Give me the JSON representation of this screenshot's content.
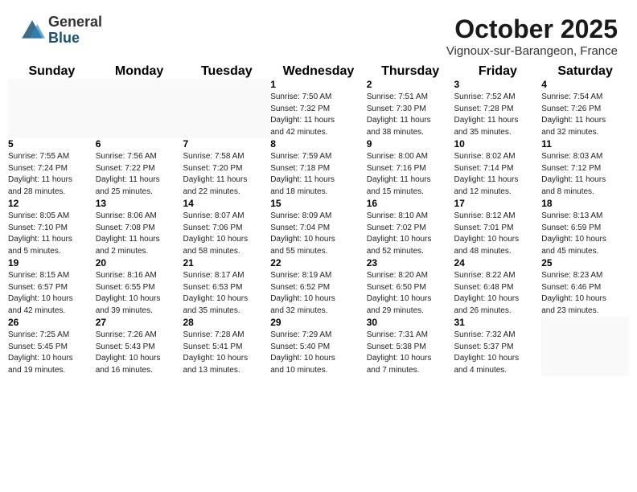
{
  "header": {
    "logo_general": "General",
    "logo_blue": "Blue",
    "month_title": "October 2025",
    "subtitle": "Vignoux-sur-Barangeon, France"
  },
  "days_of_week": [
    "Sunday",
    "Monday",
    "Tuesday",
    "Wednesday",
    "Thursday",
    "Friday",
    "Saturday"
  ],
  "weeks": [
    [
      {
        "day": "",
        "info": ""
      },
      {
        "day": "",
        "info": ""
      },
      {
        "day": "",
        "info": ""
      },
      {
        "day": "1",
        "info": "Sunrise: 7:50 AM\nSunset: 7:32 PM\nDaylight: 11 hours\nand 42 minutes."
      },
      {
        "day": "2",
        "info": "Sunrise: 7:51 AM\nSunset: 7:30 PM\nDaylight: 11 hours\nand 38 minutes."
      },
      {
        "day": "3",
        "info": "Sunrise: 7:52 AM\nSunset: 7:28 PM\nDaylight: 11 hours\nand 35 minutes."
      },
      {
        "day": "4",
        "info": "Sunrise: 7:54 AM\nSunset: 7:26 PM\nDaylight: 11 hours\nand 32 minutes."
      }
    ],
    [
      {
        "day": "5",
        "info": "Sunrise: 7:55 AM\nSunset: 7:24 PM\nDaylight: 11 hours\nand 28 minutes."
      },
      {
        "day": "6",
        "info": "Sunrise: 7:56 AM\nSunset: 7:22 PM\nDaylight: 11 hours\nand 25 minutes."
      },
      {
        "day": "7",
        "info": "Sunrise: 7:58 AM\nSunset: 7:20 PM\nDaylight: 11 hours\nand 22 minutes."
      },
      {
        "day": "8",
        "info": "Sunrise: 7:59 AM\nSunset: 7:18 PM\nDaylight: 11 hours\nand 18 minutes."
      },
      {
        "day": "9",
        "info": "Sunrise: 8:00 AM\nSunset: 7:16 PM\nDaylight: 11 hours\nand 15 minutes."
      },
      {
        "day": "10",
        "info": "Sunrise: 8:02 AM\nSunset: 7:14 PM\nDaylight: 11 hours\nand 12 minutes."
      },
      {
        "day": "11",
        "info": "Sunrise: 8:03 AM\nSunset: 7:12 PM\nDaylight: 11 hours\nand 8 minutes."
      }
    ],
    [
      {
        "day": "12",
        "info": "Sunrise: 8:05 AM\nSunset: 7:10 PM\nDaylight: 11 hours\nand 5 minutes."
      },
      {
        "day": "13",
        "info": "Sunrise: 8:06 AM\nSunset: 7:08 PM\nDaylight: 11 hours\nand 2 minutes."
      },
      {
        "day": "14",
        "info": "Sunrise: 8:07 AM\nSunset: 7:06 PM\nDaylight: 10 hours\nand 58 minutes."
      },
      {
        "day": "15",
        "info": "Sunrise: 8:09 AM\nSunset: 7:04 PM\nDaylight: 10 hours\nand 55 minutes."
      },
      {
        "day": "16",
        "info": "Sunrise: 8:10 AM\nSunset: 7:02 PM\nDaylight: 10 hours\nand 52 minutes."
      },
      {
        "day": "17",
        "info": "Sunrise: 8:12 AM\nSunset: 7:01 PM\nDaylight: 10 hours\nand 48 minutes."
      },
      {
        "day": "18",
        "info": "Sunrise: 8:13 AM\nSunset: 6:59 PM\nDaylight: 10 hours\nand 45 minutes."
      }
    ],
    [
      {
        "day": "19",
        "info": "Sunrise: 8:15 AM\nSunset: 6:57 PM\nDaylight: 10 hours\nand 42 minutes."
      },
      {
        "day": "20",
        "info": "Sunrise: 8:16 AM\nSunset: 6:55 PM\nDaylight: 10 hours\nand 39 minutes."
      },
      {
        "day": "21",
        "info": "Sunrise: 8:17 AM\nSunset: 6:53 PM\nDaylight: 10 hours\nand 35 minutes."
      },
      {
        "day": "22",
        "info": "Sunrise: 8:19 AM\nSunset: 6:52 PM\nDaylight: 10 hours\nand 32 minutes."
      },
      {
        "day": "23",
        "info": "Sunrise: 8:20 AM\nSunset: 6:50 PM\nDaylight: 10 hours\nand 29 minutes."
      },
      {
        "day": "24",
        "info": "Sunrise: 8:22 AM\nSunset: 6:48 PM\nDaylight: 10 hours\nand 26 minutes."
      },
      {
        "day": "25",
        "info": "Sunrise: 8:23 AM\nSunset: 6:46 PM\nDaylight: 10 hours\nand 23 minutes."
      }
    ],
    [
      {
        "day": "26",
        "info": "Sunrise: 7:25 AM\nSunset: 5:45 PM\nDaylight: 10 hours\nand 19 minutes."
      },
      {
        "day": "27",
        "info": "Sunrise: 7:26 AM\nSunset: 5:43 PM\nDaylight: 10 hours\nand 16 minutes."
      },
      {
        "day": "28",
        "info": "Sunrise: 7:28 AM\nSunset: 5:41 PM\nDaylight: 10 hours\nand 13 minutes."
      },
      {
        "day": "29",
        "info": "Sunrise: 7:29 AM\nSunset: 5:40 PM\nDaylight: 10 hours\nand 10 minutes."
      },
      {
        "day": "30",
        "info": "Sunrise: 7:31 AM\nSunset: 5:38 PM\nDaylight: 10 hours\nand 7 minutes."
      },
      {
        "day": "31",
        "info": "Sunrise: 7:32 AM\nSunset: 5:37 PM\nDaylight: 10 hours\nand 4 minutes."
      },
      {
        "day": "",
        "info": ""
      }
    ]
  ]
}
